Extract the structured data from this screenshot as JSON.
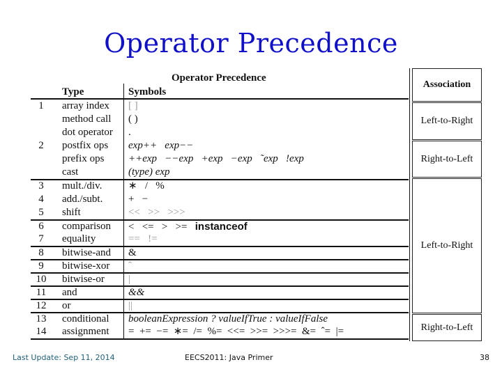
{
  "slide": {
    "title": "Operator Precedence",
    "table_caption": "Operator Precedence"
  },
  "table": {
    "headers": {
      "type": "Type",
      "symbols": "Symbols"
    },
    "rows": [
      {
        "num": "1",
        "type": "array index",
        "symbols": "[ ]"
      },
      {
        "num": "",
        "type": "method call",
        "symbols": "( )"
      },
      {
        "num": "",
        "type": "dot operator",
        "symbols": "."
      },
      {
        "num": "2",
        "type": "postfix ops",
        "symbols": "exp++   exp−−"
      },
      {
        "num": "",
        "type": "prefix ops",
        "symbols": "++exp   −−exp   +exp   −exp   ˜exp   !exp"
      },
      {
        "num": "",
        "type": "cast",
        "symbols": "(type) exp"
      },
      {
        "num": "3",
        "type": "mult./div.",
        "symbols": "∗   /   %"
      },
      {
        "num": "4",
        "type": "add./subt.",
        "symbols": "+   −"
      },
      {
        "num": "5",
        "type": "shift",
        "symbols": "<<   >>   >>>"
      },
      {
        "num": "6",
        "type": "comparison",
        "symbols": "<   <=   >   >=",
        "keyword": "instanceof"
      },
      {
        "num": "7",
        "type": "equality",
        "symbols": "==   !="
      },
      {
        "num": "8",
        "type": "bitwise-and",
        "symbols": "&"
      },
      {
        "num": "9",
        "type": "bitwise-xor",
        "symbols": "ˆ"
      },
      {
        "num": "10",
        "type": "bitwise-or",
        "symbols": "|"
      },
      {
        "num": "11",
        "type": "and",
        "symbols": "&&"
      },
      {
        "num": "12",
        "type": "or",
        "symbols": "||"
      },
      {
        "num": "13",
        "type": "conditional",
        "symbols": "booleanExpression ? valueIfTrue : valueIfFalse"
      },
      {
        "num": "14",
        "type": "assignment",
        "symbols": "=  +=  −=  ∗=  /=  %=  <<=  >>=  >>>=  &=  ˆ=  |="
      }
    ]
  },
  "association": {
    "header": "Association",
    "cells": [
      "Left-to-Right",
      "Right-to-Left",
      "Left-to-Right",
      "Right-to-Left"
    ]
  },
  "footer": {
    "left": "Last Update: Sep 11, 2014",
    "center": "EECS2011: Java Primer",
    "page": "38"
  }
}
